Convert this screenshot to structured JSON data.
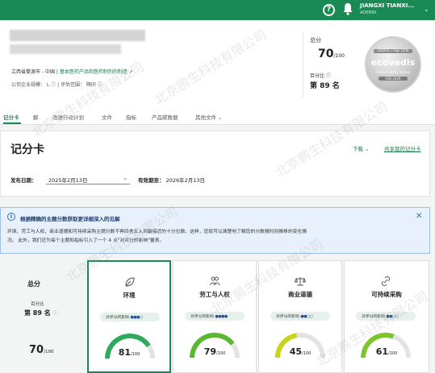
{
  "topbar": {
    "help_glyph": "?",
    "user_name": "JIANGXI TIANXI...",
    "user_sub": "ADEMIN",
    "caret": "⌄"
  },
  "company": {
    "location": "江西省婺源市 - 中国 |",
    "industry_link": "基本医药产品和医药制剂的制造",
    "meta": "公司企业规模： L  ⓘ  | 评估范围： 隔间 ⓘ"
  },
  "score_summary": {
    "total_label": "总分",
    "total_value": "70",
    "total_max": "/100",
    "percentile_label": "百分比 ⓘ",
    "rank": "第 89 名"
  },
  "medal": {
    "tier": "SILVER | Top 15%",
    "brand": "ecovadis",
    "tagline": "Sustainability Rating",
    "date": "FEB 2026"
  },
  "tabs": [
    {
      "label": "记分卡"
    },
    {
      "label": "解"
    },
    {
      "label": "改进行动计划"
    },
    {
      "label": "文件"
    },
    {
      "label": "指标"
    },
    {
      "label": "产品碳数据"
    },
    {
      "label": "其他文件 ⌄"
    }
  ],
  "scorecard": {
    "title": "记分卡",
    "download": "下载  ⌄",
    "share": "共享我的记分卡",
    "publish_label": "发布日期：",
    "publish_value": "2025年2月13日",
    "valid_label": "有效期至：",
    "valid_value": "2026年2月13日"
  },
  "info": {
    "icon": "i",
    "heading": "根据精确的主题分数获取更详细深入的见解",
    "body1": "环境、劳工与人权、商业道德和可持续采购主题分数不再四舍五入到最接近的十分位数。这样，您就可以清楚地了解您的分数随时间推移的变化情",
    "body2": "况。 此外，我们还为每个主题和指标引入了一个 4 点\"对评分的影响\"量表。",
    "close": "✕"
  },
  "overall": {
    "label": "总分",
    "percentile_label": "百分比",
    "rank": "第 89 名",
    "rank_icon": "ⓘ",
    "value": "70",
    "max": "/100"
  },
  "themes": [
    {
      "name": "环境",
      "impact_label": "对评分的影响",
      "impact_dots": "●●●○",
      "score": "81",
      "max": "/100",
      "score_num": 81,
      "color": "#2eaa5f",
      "icon": "leaf-icon"
    },
    {
      "name": "劳工与人权",
      "impact_label": "对评分的影响",
      "impact_dots": "●●●●",
      "score": "79",
      "max": "/100",
      "score_num": 79,
      "color": "#5cb833",
      "icon": "people-icon"
    },
    {
      "name": "商业道德",
      "impact_label": "对评分的影响",
      "impact_dots": "●●○○",
      "score": "45",
      "max": "/100",
      "score_num": 45,
      "color": "#c8d41c",
      "icon": "scale-icon"
    },
    {
      "name": "可持续采购",
      "impact_label": "对评分的影响",
      "impact_dots": "●●○○",
      "score": "61",
      "max": "/100",
      "score_num": 61,
      "color": "#7cc52c",
      "icon": "link-icon"
    }
  ],
  "watermark": "北京鹏生科技有限公司"
}
